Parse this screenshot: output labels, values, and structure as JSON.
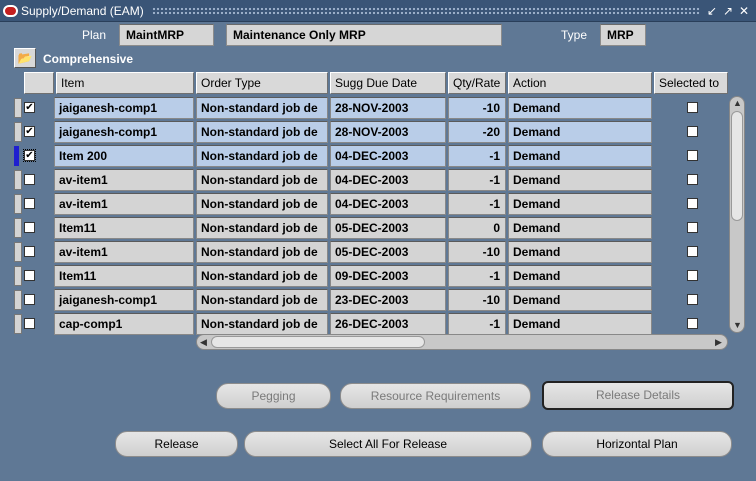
{
  "window": {
    "title": "Supply/Demand (EAM)"
  },
  "header": {
    "plan_label": "Plan",
    "plan_value": "MaintMRP",
    "plan_desc": "Maintenance Only MRP",
    "type_label": "Type",
    "type_value": "MRP"
  },
  "folder": {
    "title": "Comprehensive"
  },
  "grid": {
    "columns": [
      "Item",
      "Order Type",
      "Sugg Due Date",
      "Qty/Rate",
      "Action",
      "Selected to"
    ],
    "rows": [
      {
        "item": "jaiganesh-comp1",
        "order_type": "Non-standard job de",
        "due_date": "28-NOV-2003",
        "qty": "-10",
        "action": "Demand",
        "checked": true,
        "highlight": true,
        "current": false
      },
      {
        "item": "jaiganesh-comp1",
        "order_type": "Non-standard job de",
        "due_date": "28-NOV-2003",
        "qty": "-20",
        "action": "Demand",
        "checked": true,
        "highlight": true,
        "current": false
      },
      {
        "item": "Item 200",
        "order_type": "Non-standard job de",
        "due_date": "04-DEC-2003",
        "qty": "-1",
        "action": "Demand",
        "checked": true,
        "highlight": true,
        "current": true
      },
      {
        "item": "av-item1",
        "order_type": "Non-standard job de",
        "due_date": "04-DEC-2003",
        "qty": "-1",
        "action": "Demand",
        "checked": false,
        "highlight": false,
        "current": false
      },
      {
        "item": "av-item1",
        "order_type": "Non-standard job de",
        "due_date": "04-DEC-2003",
        "qty": "-1",
        "action": "Demand",
        "checked": false,
        "highlight": false,
        "current": false
      },
      {
        "item": "Item11",
        "order_type": "Non-standard job de",
        "due_date": "05-DEC-2003",
        "qty": "0",
        "action": "Demand",
        "checked": false,
        "highlight": false,
        "current": false
      },
      {
        "item": "av-item1",
        "order_type": "Non-standard job de",
        "due_date": "05-DEC-2003",
        "qty": "-10",
        "action": "Demand",
        "checked": false,
        "highlight": false,
        "current": false
      },
      {
        "item": "Item11",
        "order_type": "Non-standard job de",
        "due_date": "09-DEC-2003",
        "qty": "-1",
        "action": "Demand",
        "checked": false,
        "highlight": false,
        "current": false
      },
      {
        "item": "jaiganesh-comp1",
        "order_type": "Non-standard job de",
        "due_date": "23-DEC-2003",
        "qty": "-10",
        "action": "Demand",
        "checked": false,
        "highlight": false,
        "current": false
      },
      {
        "item": "cap-comp1",
        "order_type": "Non-standard job de",
        "due_date": "26-DEC-2003",
        "qty": "-1",
        "action": "Demand",
        "checked": false,
        "highlight": false,
        "current": false
      }
    ]
  },
  "buttons": {
    "pegging": "Pegging",
    "resource_requirements": "Resource Requirements",
    "release_details": "Release Details",
    "release": "Release",
    "select_all": "Select All For Release",
    "horizontal_plan": "Horizontal Plan"
  },
  "colors": {
    "background": "#5f7895",
    "selected_row": "#b9cde8",
    "titlebar": "#3a5577"
  }
}
